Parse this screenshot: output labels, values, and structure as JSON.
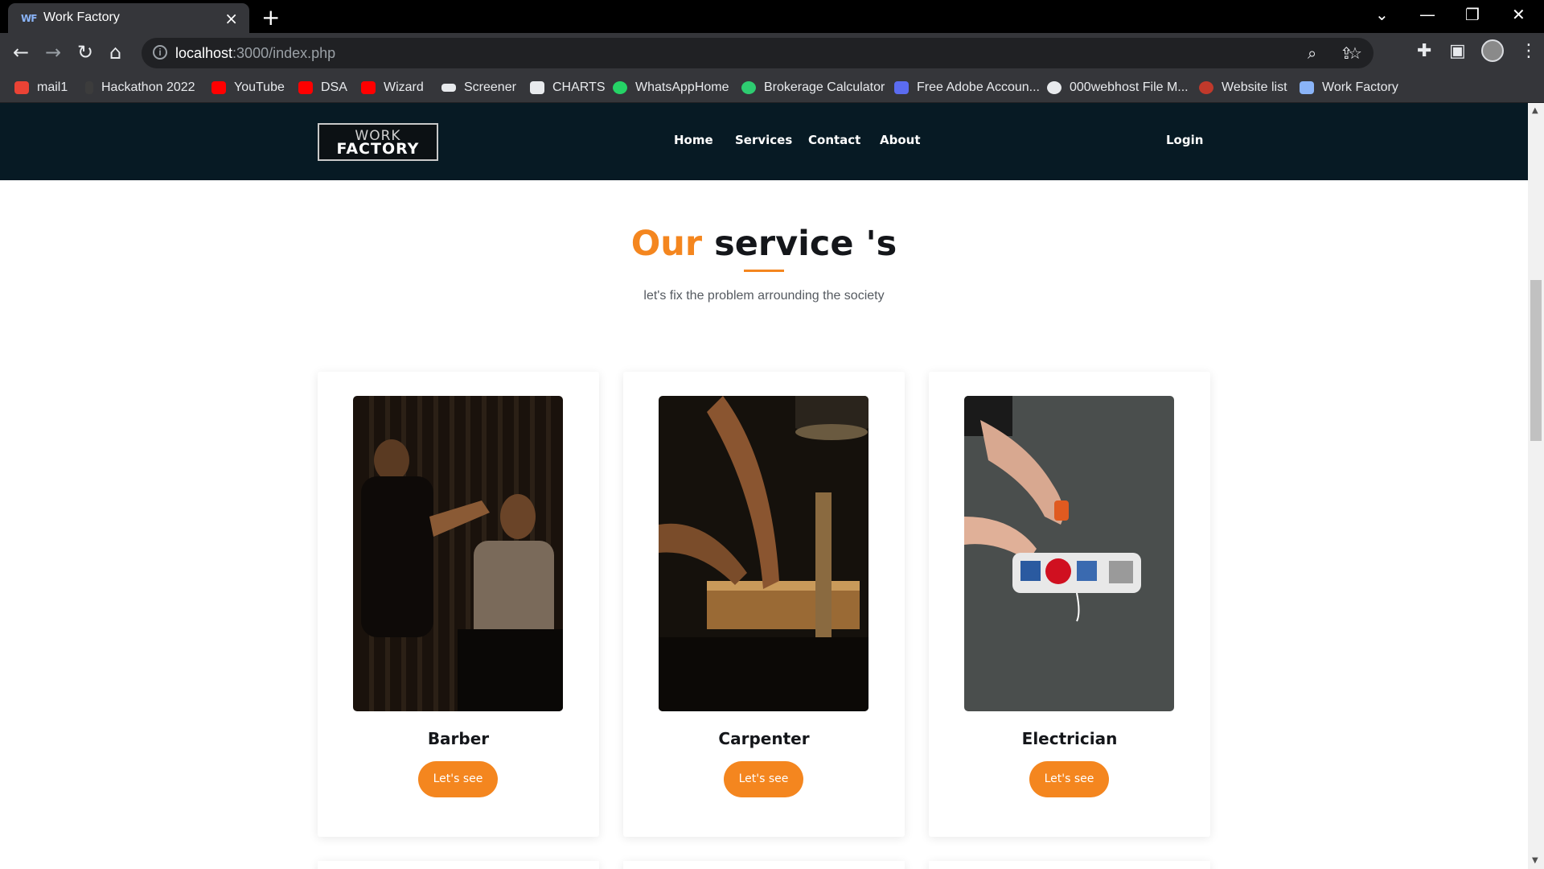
{
  "browser": {
    "tab_title": "Work Factory",
    "tab_favicon_text": "WF",
    "tab_close_glyph": "×",
    "new_tab_glyph": "+",
    "url_host": "localhost",
    "url_path": ":3000/index.php",
    "window_controls": {
      "tabs_menu": "⌄",
      "minimize": "—",
      "restore": "❐",
      "close": "✕"
    },
    "bookmarks": [
      {
        "label": "mail1",
        "icon": "gmail-icon",
        "color": "#ea4335"
      },
      {
        "label": "Hackathon 2022",
        "icon": "bottle-icon",
        "color": "#3c3c3c"
      },
      {
        "label": "YouTube",
        "icon": "youtube-icon",
        "color": "#ff0000"
      },
      {
        "label": "DSA",
        "icon": "youtube-icon",
        "color": "#ff0000"
      },
      {
        "label": "Wizard",
        "icon": "youtube-icon",
        "color": "#ff0000"
      },
      {
        "label": "Screener",
        "icon": "screener-icon",
        "color": "#e8eaed"
      },
      {
        "label": "CHARTS",
        "icon": "tradingview-icon",
        "color": "#e8eaed"
      },
      {
        "label": "WhatsAppHome",
        "icon": "whatsapp-icon",
        "color": "#25d366"
      },
      {
        "label": "Brokerage Calculator",
        "icon": "zerodha-icon",
        "color": "#2ecc71"
      },
      {
        "label": "Free Adobe Accoun...",
        "icon": "adobe-icon",
        "color": "#5b6cf0"
      },
      {
        "label": "000webhost File M...",
        "icon": "globe-icon",
        "color": "#e8eaed"
      },
      {
        "label": "Website list",
        "icon": "website-list-icon",
        "color": "#c0392b"
      },
      {
        "label": "Work Factory",
        "icon": "wf-icon",
        "color": "#8ab4f8"
      }
    ]
  },
  "site": {
    "logo_line1": "WORK",
    "logo_line2": "FACTORY",
    "nav": [
      "Home",
      "Services",
      "Contact",
      "About"
    ],
    "login": "Login",
    "accent_color": "#f4861f",
    "nav_bg_color": "#071a24"
  },
  "services": {
    "title_accent": "Our",
    "title_rest": "service 's",
    "subtitle": "let's fix the problem arrounding the society",
    "cards": [
      {
        "title": "Barber",
        "button": "Let's see",
        "image": "barber-photo"
      },
      {
        "title": "Carpenter",
        "button": "Let's see",
        "image": "carpenter-photo"
      },
      {
        "title": "Electrician",
        "button": "Let's see",
        "image": "electrician-photo"
      }
    ]
  }
}
